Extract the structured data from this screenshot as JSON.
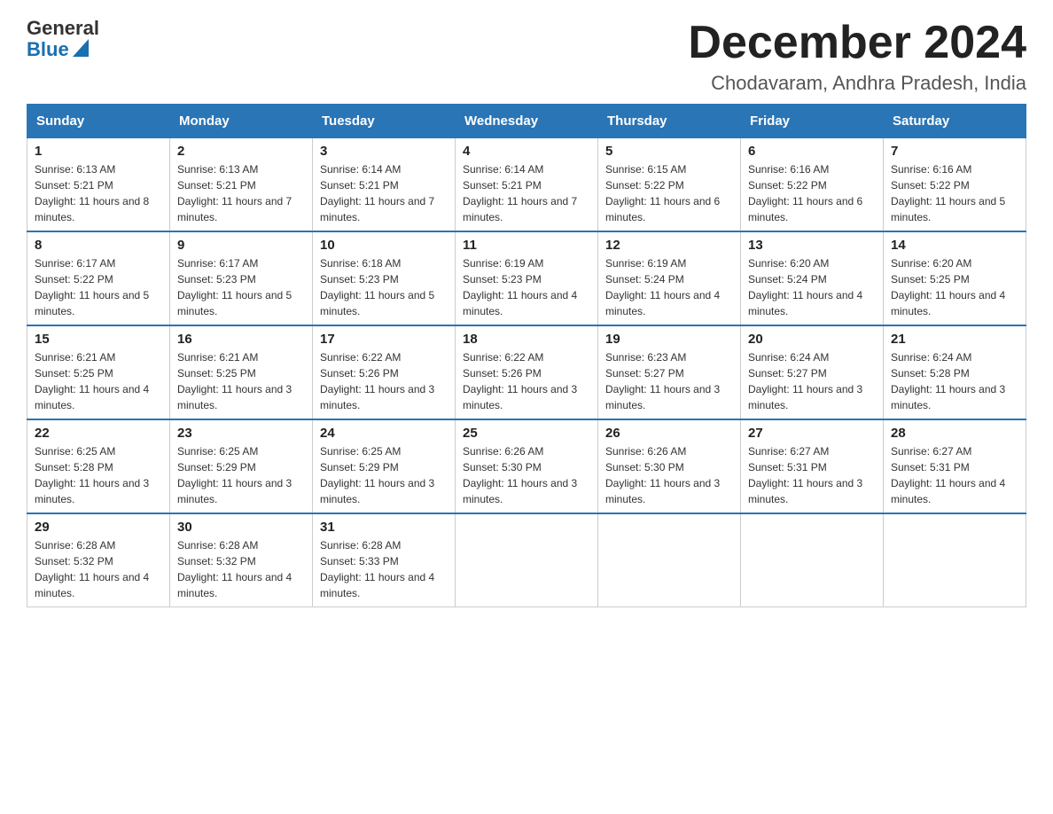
{
  "header": {
    "logo": {
      "general": "General",
      "blue": "Blue"
    },
    "title": "December 2024",
    "subtitle": "Chodavaram, Andhra Pradesh, India"
  },
  "days_of_week": [
    "Sunday",
    "Monday",
    "Tuesday",
    "Wednesday",
    "Thursday",
    "Friday",
    "Saturday"
  ],
  "weeks": [
    [
      {
        "day": "1",
        "sunrise": "6:13 AM",
        "sunset": "5:21 PM",
        "daylight": "11 hours and 8 minutes."
      },
      {
        "day": "2",
        "sunrise": "6:13 AM",
        "sunset": "5:21 PM",
        "daylight": "11 hours and 7 minutes."
      },
      {
        "day": "3",
        "sunrise": "6:14 AM",
        "sunset": "5:21 PM",
        "daylight": "11 hours and 7 minutes."
      },
      {
        "day": "4",
        "sunrise": "6:14 AM",
        "sunset": "5:21 PM",
        "daylight": "11 hours and 7 minutes."
      },
      {
        "day": "5",
        "sunrise": "6:15 AM",
        "sunset": "5:22 PM",
        "daylight": "11 hours and 6 minutes."
      },
      {
        "day": "6",
        "sunrise": "6:16 AM",
        "sunset": "5:22 PM",
        "daylight": "11 hours and 6 minutes."
      },
      {
        "day": "7",
        "sunrise": "6:16 AM",
        "sunset": "5:22 PM",
        "daylight": "11 hours and 5 minutes."
      }
    ],
    [
      {
        "day": "8",
        "sunrise": "6:17 AM",
        "sunset": "5:22 PM",
        "daylight": "11 hours and 5 minutes."
      },
      {
        "day": "9",
        "sunrise": "6:17 AM",
        "sunset": "5:23 PM",
        "daylight": "11 hours and 5 minutes."
      },
      {
        "day": "10",
        "sunrise": "6:18 AM",
        "sunset": "5:23 PM",
        "daylight": "11 hours and 5 minutes."
      },
      {
        "day": "11",
        "sunrise": "6:19 AM",
        "sunset": "5:23 PM",
        "daylight": "11 hours and 4 minutes."
      },
      {
        "day": "12",
        "sunrise": "6:19 AM",
        "sunset": "5:24 PM",
        "daylight": "11 hours and 4 minutes."
      },
      {
        "day": "13",
        "sunrise": "6:20 AM",
        "sunset": "5:24 PM",
        "daylight": "11 hours and 4 minutes."
      },
      {
        "day": "14",
        "sunrise": "6:20 AM",
        "sunset": "5:25 PM",
        "daylight": "11 hours and 4 minutes."
      }
    ],
    [
      {
        "day": "15",
        "sunrise": "6:21 AM",
        "sunset": "5:25 PM",
        "daylight": "11 hours and 4 minutes."
      },
      {
        "day": "16",
        "sunrise": "6:21 AM",
        "sunset": "5:25 PM",
        "daylight": "11 hours and 3 minutes."
      },
      {
        "day": "17",
        "sunrise": "6:22 AM",
        "sunset": "5:26 PM",
        "daylight": "11 hours and 3 minutes."
      },
      {
        "day": "18",
        "sunrise": "6:22 AM",
        "sunset": "5:26 PM",
        "daylight": "11 hours and 3 minutes."
      },
      {
        "day": "19",
        "sunrise": "6:23 AM",
        "sunset": "5:27 PM",
        "daylight": "11 hours and 3 minutes."
      },
      {
        "day": "20",
        "sunrise": "6:24 AM",
        "sunset": "5:27 PM",
        "daylight": "11 hours and 3 minutes."
      },
      {
        "day": "21",
        "sunrise": "6:24 AM",
        "sunset": "5:28 PM",
        "daylight": "11 hours and 3 minutes."
      }
    ],
    [
      {
        "day": "22",
        "sunrise": "6:25 AM",
        "sunset": "5:28 PM",
        "daylight": "11 hours and 3 minutes."
      },
      {
        "day": "23",
        "sunrise": "6:25 AM",
        "sunset": "5:29 PM",
        "daylight": "11 hours and 3 minutes."
      },
      {
        "day": "24",
        "sunrise": "6:25 AM",
        "sunset": "5:29 PM",
        "daylight": "11 hours and 3 minutes."
      },
      {
        "day": "25",
        "sunrise": "6:26 AM",
        "sunset": "5:30 PM",
        "daylight": "11 hours and 3 minutes."
      },
      {
        "day": "26",
        "sunrise": "6:26 AM",
        "sunset": "5:30 PM",
        "daylight": "11 hours and 3 minutes."
      },
      {
        "day": "27",
        "sunrise": "6:27 AM",
        "sunset": "5:31 PM",
        "daylight": "11 hours and 3 minutes."
      },
      {
        "day": "28",
        "sunrise": "6:27 AM",
        "sunset": "5:31 PM",
        "daylight": "11 hours and 4 minutes."
      }
    ],
    [
      {
        "day": "29",
        "sunrise": "6:28 AM",
        "sunset": "5:32 PM",
        "daylight": "11 hours and 4 minutes."
      },
      {
        "day": "30",
        "sunrise": "6:28 AM",
        "sunset": "5:32 PM",
        "daylight": "11 hours and 4 minutes."
      },
      {
        "day": "31",
        "sunrise": "6:28 AM",
        "sunset": "5:33 PM",
        "daylight": "11 hours and 4 minutes."
      },
      null,
      null,
      null,
      null
    ]
  ]
}
